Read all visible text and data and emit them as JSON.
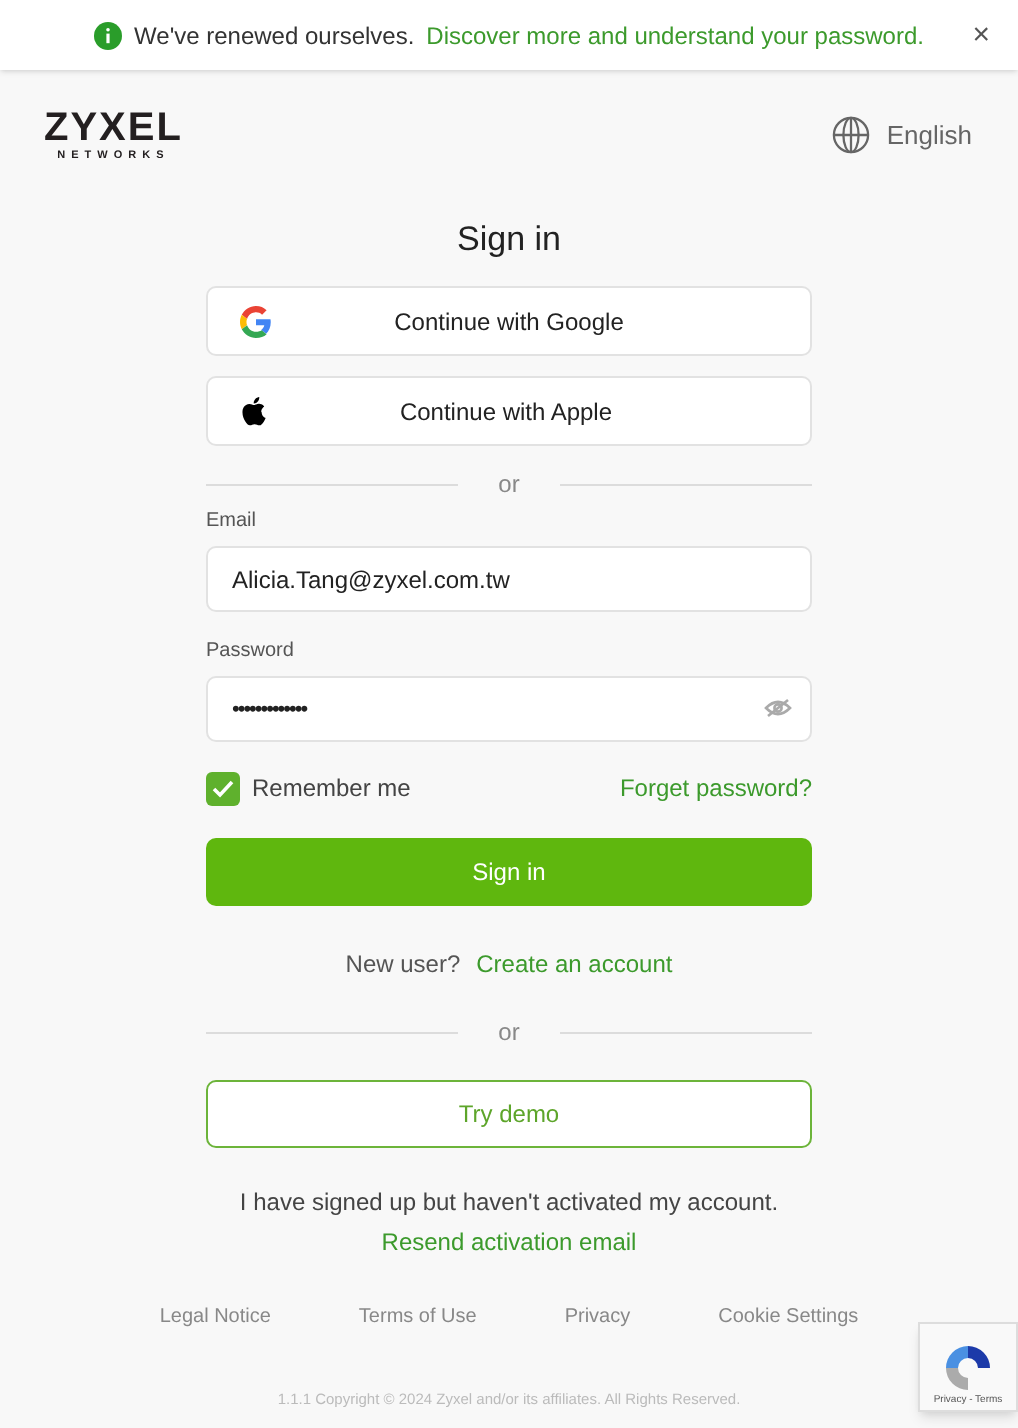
{
  "banner": {
    "message": "We've renewed ourselves.",
    "link": "Discover more and understand your password.",
    "close": "×"
  },
  "logo": {
    "name": "ZYXEL",
    "tagline": "NETWORKS"
  },
  "language": "English",
  "title": "Sign in",
  "social_buttons": [
    {
      "kind": "google",
      "label": "Continue with Google"
    },
    {
      "kind": "apple",
      "label": "Continue with Apple"
    }
  ],
  "divider_1": "or",
  "email": {
    "label": "Email",
    "value": "Alicia.Tang@zyxel.com.tw"
  },
  "password": {
    "label": "Password",
    "value": "•••••••••••••"
  },
  "remember_me": {
    "label": "Remember me",
    "checked": true
  },
  "forget_password": "Forget password?",
  "sign_in_button": "Sign in",
  "new_user": {
    "text": "New user?",
    "link": "Create an account"
  },
  "divider_2": "or",
  "try_demo": "Try demo",
  "activation": {
    "text": "I have signed up but haven't activated my account.",
    "link": "Resend activation email"
  },
  "footer_links": [
    "Legal Notice",
    "Terms of Use",
    "Privacy",
    "Cookie Settings"
  ],
  "copyright": "1.1.1 Copyright © 2024 Zyxel and/or its affiliates. All Rights Reserved.",
  "recaptcha": {
    "label": "Privacy - Terms"
  }
}
